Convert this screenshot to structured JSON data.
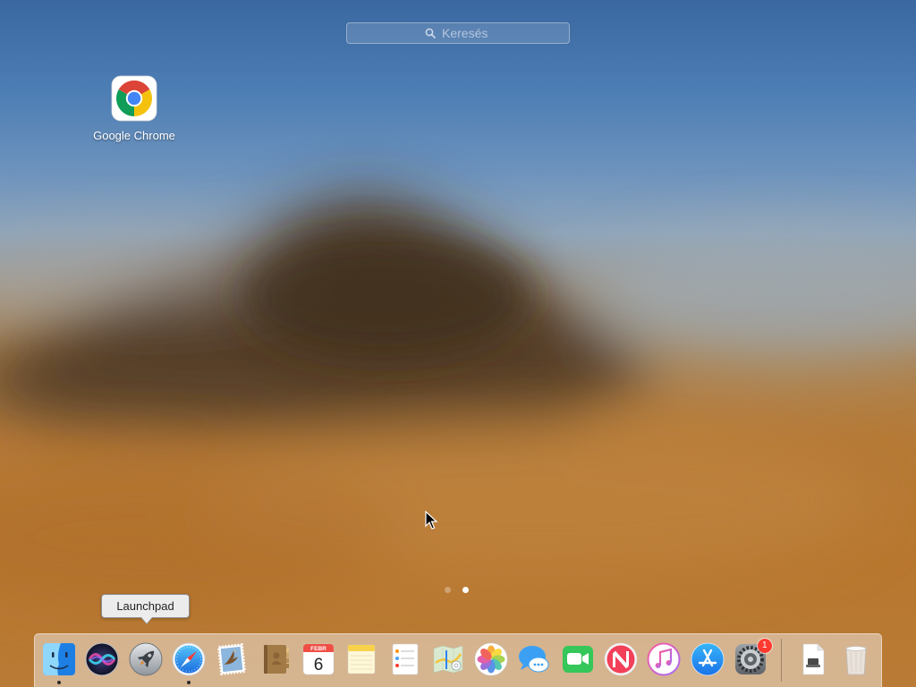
{
  "search": {
    "placeholder": "Keresés",
    "icon": "search-icon"
  },
  "launchpad": {
    "apps": [
      {
        "label": "Google Chrome",
        "icon": "chrome-icon"
      }
    ],
    "pagination": {
      "page_count": 2,
      "active_page": 2
    }
  },
  "tooltip": {
    "text": "Launchpad"
  },
  "dock": {
    "items": [
      {
        "icon": "finder-icon",
        "running": true
      },
      {
        "icon": "siri-icon",
        "running": false
      },
      {
        "icon": "launchpad-icon",
        "running": false
      },
      {
        "icon": "safari-icon",
        "running": true
      },
      {
        "icon": "mail-icon",
        "running": false
      },
      {
        "icon": "contacts-icon",
        "running": false
      },
      {
        "icon": "calendar-icon",
        "running": false
      },
      {
        "icon": "notes-icon",
        "running": false
      },
      {
        "icon": "reminders-icon",
        "running": false
      },
      {
        "icon": "maps-icon",
        "running": false
      },
      {
        "icon": "photos-icon",
        "running": false
      },
      {
        "icon": "messages-icon",
        "running": false
      },
      {
        "icon": "facetime-icon",
        "running": false
      },
      {
        "icon": "news-icon",
        "running": false
      },
      {
        "icon": "itunes-icon",
        "running": false
      },
      {
        "icon": "app-store-icon",
        "running": false
      },
      {
        "icon": "system-preferences-icon",
        "running": false,
        "badge": "1"
      },
      {
        "icon": "document-stack-icon",
        "running": false
      },
      {
        "icon": "trash-icon",
        "running": false
      }
    ],
    "calendar": {
      "month": "FEBR",
      "day": "6"
    }
  },
  "colors": {
    "badge": "#ff3b30",
    "page_dot_active": "#ffffff"
  }
}
